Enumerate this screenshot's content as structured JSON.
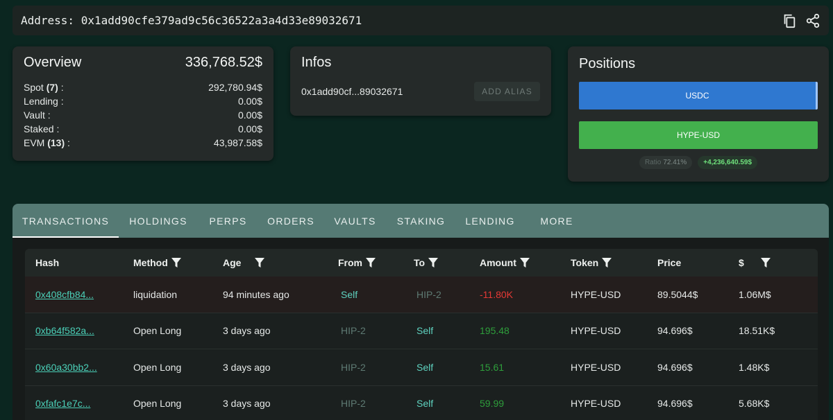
{
  "address": {
    "label": "Address: 0x1add90cfe379ad9c56c36522a3a4d33e89032671"
  },
  "overview": {
    "title": "Overview",
    "total": "336,768.52$",
    "rows": [
      {
        "label": "Spot",
        "count": "(7)",
        "suffix": " :",
        "value": "292,780.94$"
      },
      {
        "label": "Lending :",
        "count": "",
        "suffix": "",
        "value": "0.00$"
      },
      {
        "label": "Vault :",
        "count": "",
        "suffix": "",
        "value": "0.00$"
      },
      {
        "label": "Staked :",
        "count": "",
        "suffix": "",
        "value": "0.00$"
      },
      {
        "label": "EVM",
        "count": "(13)",
        "suffix": " :",
        "value": "43,987.58$"
      }
    ]
  },
  "infos": {
    "title": "Infos",
    "short_address": "0x1add90cf...89032671",
    "alias_button": "ADD ALIAS"
  },
  "positions": {
    "title": "Positions",
    "bars": [
      {
        "label": "USDC",
        "color": "#2f78d0"
      },
      {
        "label": "HYPE-USD",
        "color": "#43b04d"
      }
    ],
    "ratio_label": "Ratio",
    "ratio_value": "72.41%",
    "pnl": "+4,236,640.59$"
  },
  "tabs": [
    "TRANSACTIONS",
    "HOLDINGS",
    "PERPS",
    "ORDERS",
    "VAULTS",
    "STAKING",
    "LENDING",
    "MORE"
  ],
  "table": {
    "headers": [
      "Hash",
      "Method",
      "Age",
      "From",
      "To",
      "Amount",
      "Token",
      "Price",
      "$"
    ],
    "rows": [
      {
        "hash": "0x408cfb84...",
        "method": "liquidation",
        "age": "94 minutes ago",
        "from": "Self",
        "to": "HIP-2",
        "amount": "-11.80K",
        "token": "HYPE-USD",
        "price": "89.5044$",
        "usd": "1.06M$"
      },
      {
        "hash": "0xb64f582a...",
        "method": "Open Long",
        "age": "3 days ago",
        "from": "HIP-2",
        "to": "Self",
        "amount": "195.48",
        "token": "HYPE-USD",
        "price": "94.696$",
        "usd": "18.51K$"
      },
      {
        "hash": "0x60a30bb2...",
        "method": "Open Long",
        "age": "3 days ago",
        "from": "HIP-2",
        "to": "Self",
        "amount": "15.61",
        "token": "HYPE-USD",
        "price": "94.696$",
        "usd": "1.48K$"
      },
      {
        "hash": "0xfafc1e7c...",
        "method": "Open Long",
        "age": "3 days ago",
        "from": "HIP-2",
        "to": "Self",
        "amount": "59.99",
        "token": "HYPE-USD",
        "price": "94.696$",
        "usd": "5.68K$"
      }
    ]
  },
  "colors": {
    "self": "#5fd3c0",
    "hip": "#5e7a73",
    "negative": "#e53935",
    "positive": "#2e9e3b",
    "tabs_bg": "#557a74"
  },
  "icons": {
    "copy": "copy-icon",
    "share": "share-icon",
    "filter": "filter-icon"
  }
}
